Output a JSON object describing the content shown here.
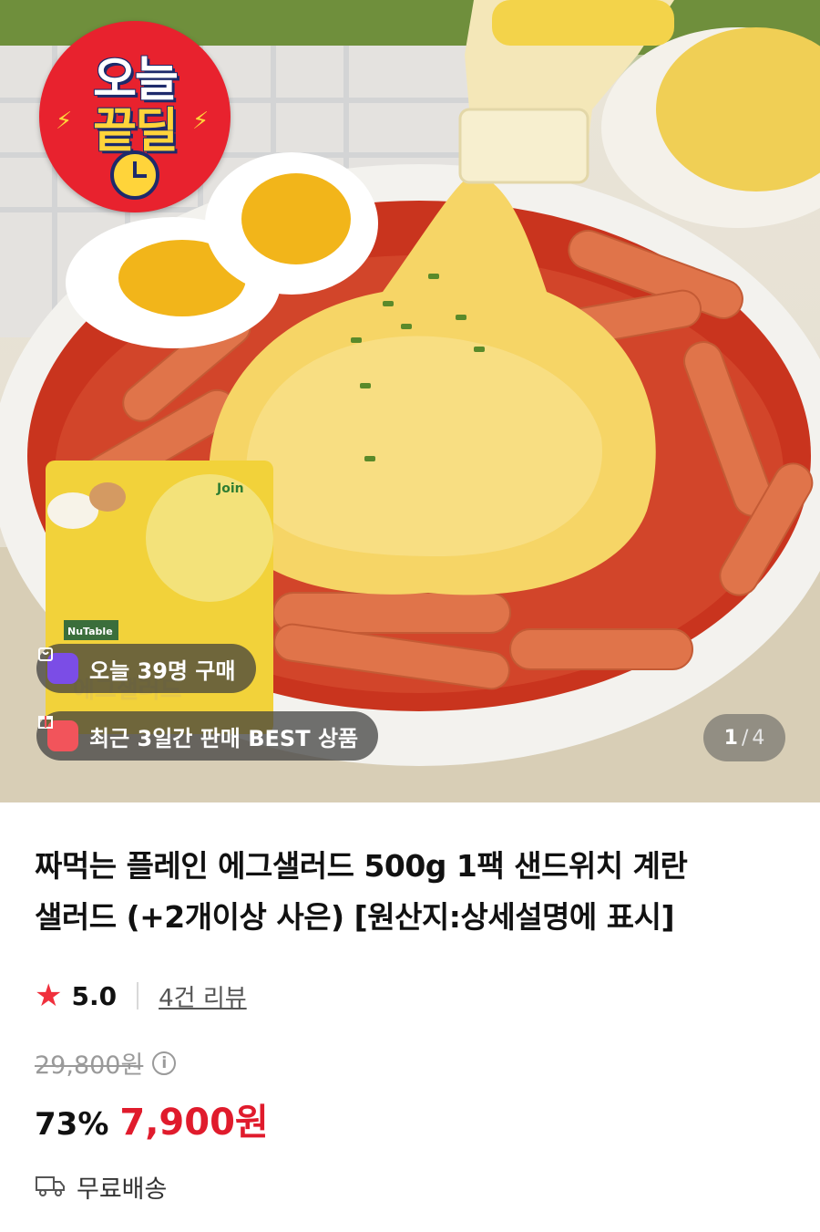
{
  "hero": {
    "deal_badge": {
      "line1": "오늘",
      "line2": "끝딜"
    },
    "package_brand": "Join",
    "package_line": "NuTable",
    "package_label": "에그샐러드",
    "purchase_pill": "오늘 39명 구매",
    "best_pill": "최근 3일간 판매 BEST 상품",
    "pager": {
      "current": "1",
      "separator": "/",
      "total": "4"
    }
  },
  "product": {
    "title_line1": "짜먹는 플레인 에그샐러드 500g 1팩 샌드위치 계란",
    "title_line2": "샐러드 (+2개이상 사은) [원산지:상세설명에 표시]",
    "rating": "5.0",
    "review_link": "4건 리뷰",
    "original_price": "29,800원",
    "discount": "73%",
    "sale_price": "7,900원",
    "shipping": "무료배송"
  },
  "colors": {
    "accent_red": "#e01b2c",
    "star": "#f0303d",
    "badge_red": "#e8222e",
    "purchase_icon": "#7b4de6",
    "best_icon": "#f2545b"
  },
  "icons": {
    "star": "star-icon",
    "info": "info-icon",
    "truck": "truck-icon",
    "bag": "shopping-bag-icon",
    "gift": "gift-icon"
  }
}
